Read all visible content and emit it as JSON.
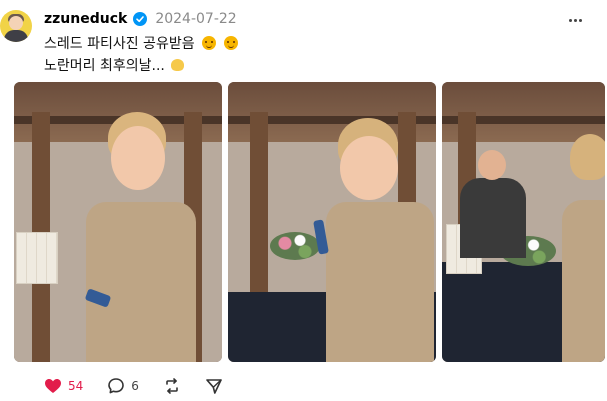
{
  "post": {
    "username": "zzuneduck",
    "date": "2024-07-22",
    "text_line1": "스레드 파티사진 공유받음",
    "text_line2": "노란머리 최후의날...",
    "likes": "54",
    "comments": "6"
  },
  "icons": {
    "verified": "verified-badge-icon",
    "more": "more-options-icon",
    "like": "heart-icon",
    "comment": "comment-icon",
    "repost": "repost-icon",
    "share": "share-icon"
  },
  "colors": {
    "accent": "#0095f6",
    "like": "#e21d4b"
  }
}
